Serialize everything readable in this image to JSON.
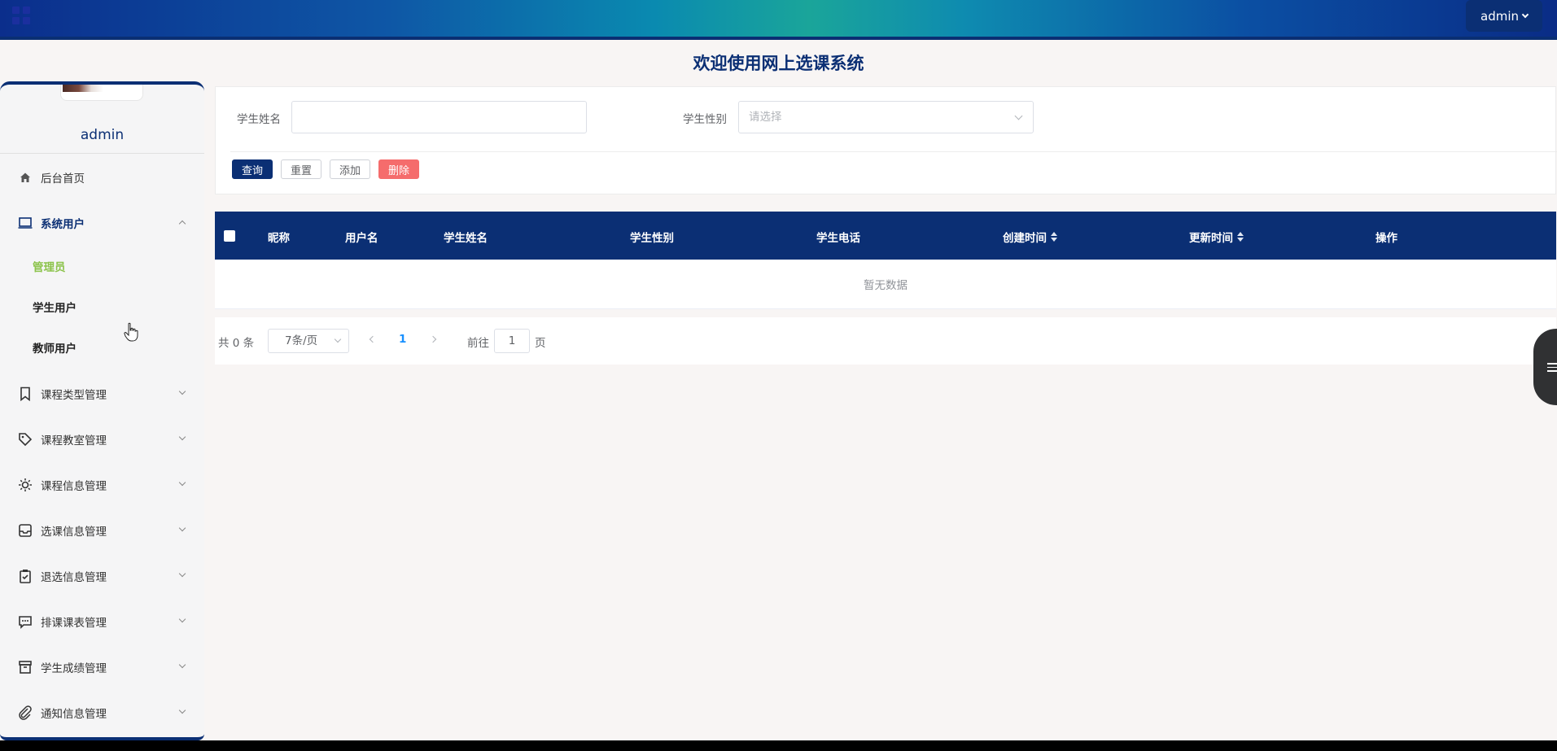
{
  "header": {
    "user_menu_label": "admin"
  },
  "page_title": "欢迎使用网上选课系统",
  "sidebar": {
    "username": "admin",
    "items": [
      {
        "label": "后台首页",
        "icon": "home-icon"
      },
      {
        "label": "系统用户",
        "icon": "monitor-icon",
        "expanded": true,
        "children": [
          {
            "label": "管理员",
            "active": true
          },
          {
            "label": "学生用户"
          },
          {
            "label": "教师用户"
          }
        ]
      },
      {
        "label": "课程类型管理",
        "icon": "bookmark-icon"
      },
      {
        "label": "课程教室管理",
        "icon": "tag-icon"
      },
      {
        "label": "课程信息管理",
        "icon": "sun-icon"
      },
      {
        "label": "选课信息管理",
        "icon": "inbox-icon"
      },
      {
        "label": "退选信息管理",
        "icon": "clipboard-check-icon"
      },
      {
        "label": "排课课表管理",
        "icon": "chat-bubble-icon"
      },
      {
        "label": "学生成绩管理",
        "icon": "archive-box-icon"
      },
      {
        "label": "通知信息管理",
        "icon": "paperclip-icon"
      }
    ]
  },
  "search": {
    "name_label": "学生姓名",
    "name_value": "",
    "gender_label": "学生性别",
    "gender_placeholder": "请选择",
    "buttons": {
      "query": "查询",
      "reset": "重置",
      "add": "添加",
      "delete": "删除"
    }
  },
  "table": {
    "columns": [
      "昵称",
      "用户名",
      "学生姓名",
      "学生性别",
      "学生电话",
      "创建时间",
      "更新时间",
      "操作"
    ],
    "empty_text": "暂无数据",
    "rows": []
  },
  "pagination": {
    "total_text": "共 0 条",
    "page_size": "7条/页",
    "current_page": "1",
    "goto_label": "前往",
    "goto_value": "1",
    "page_suffix": "页"
  },
  "colors": {
    "primary": "#0b2f74",
    "active_menu": "#8bc34a",
    "danger": "#f56c6c"
  }
}
